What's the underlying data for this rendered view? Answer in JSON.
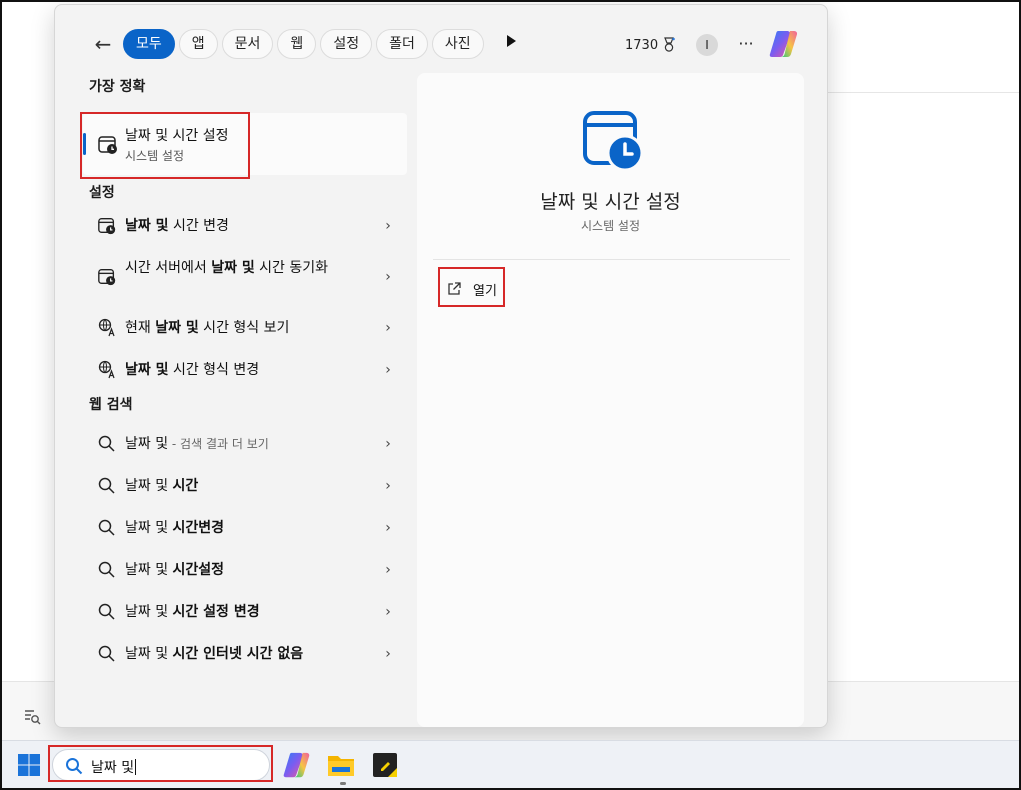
{
  "topbar": {
    "tabs": [
      "모두",
      "앱",
      "문서",
      "웹",
      "설정",
      "폴더",
      "사진"
    ],
    "active_tab": "모두",
    "points": "1730",
    "avatar_initial": "I",
    "more": "···"
  },
  "left": {
    "best_match": {
      "section": "가장 정확",
      "title": "날짜 및 시간 설정",
      "subtitle": "시스템 설정"
    },
    "settings": {
      "section": "설정",
      "items": [
        {
          "pre": "",
          "bold": "날짜 및",
          "post": " 시간 변경"
        },
        {
          "pre": "시간 서버에서 ",
          "bold": "날짜 및",
          "post": " 시간 동기화"
        },
        {
          "pre": "현재 ",
          "bold": "날짜 및",
          "post": " 시간 형식 보기"
        },
        {
          "pre": "",
          "bold": "날짜 및",
          "post": " 시간 형식 변경"
        }
      ]
    },
    "web": {
      "section": "웹 검색",
      "items": [
        {
          "query": "날짜 및",
          "suffix": " - 검색 결과 더 보기",
          "bold": ""
        },
        {
          "query": "날짜 및 ",
          "suffix": "",
          "bold": "시간"
        },
        {
          "query": "날짜 및 ",
          "suffix": "",
          "bold": "시간변경"
        },
        {
          "query": "날짜 및 ",
          "suffix": "",
          "bold": "시간설정"
        },
        {
          "query": "날짜 및 ",
          "suffix": "",
          "bold": "시간 설정 변경"
        },
        {
          "query": "날짜 및 ",
          "suffix": "",
          "bold": "시간 인터넷 시간 없음"
        }
      ]
    }
  },
  "detail": {
    "title": "날짜 및 시간 설정",
    "subtitle": "시스템 설정",
    "open_label": "열기"
  },
  "taskbar": {
    "search_value": "날짜 및"
  },
  "colors": {
    "accent": "#0a64c8",
    "highlight": "#d62828"
  }
}
